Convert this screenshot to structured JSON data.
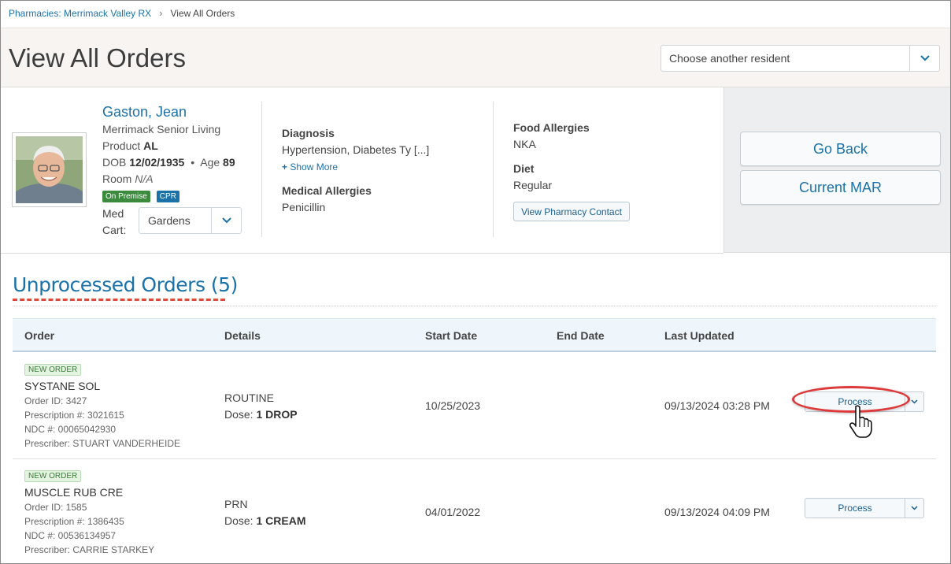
{
  "breadcrumb": {
    "parent": "Pharmacies: Merrimack Valley RX",
    "separator": "›",
    "current": "View All Orders"
  },
  "header": {
    "title": "View All Orders",
    "resident_select_placeholder": "Choose another resident"
  },
  "resident": {
    "name": "Gaston, Jean",
    "facility": "Merrimack Senior Living",
    "product_label": "Product",
    "product_value": "AL",
    "dob_label": "DOB",
    "dob_value": "12/02/1935",
    "bullet": "•",
    "age_label": "Age",
    "age_value": "89",
    "room_label": "Room",
    "room_value": "N/A",
    "badges": [
      "On Premise",
      "CPR"
    ],
    "med_cart_label": "Med Cart:",
    "med_cart_value": "Gardens"
  },
  "clinical": {
    "diagnosis_label": "Diagnosis",
    "diagnosis_value": "Hypertension, Diabetes Ty [...]",
    "show_more": "Show More",
    "medical_allergies_label": "Medical Allergies",
    "medical_allergies_value": "Penicillin",
    "food_allergies_label": "Food Allergies",
    "food_allergies_value": "NKA",
    "diet_label": "Diet",
    "diet_value": "Regular",
    "pharmacy_contact_button": "View Pharmacy Contact"
  },
  "actions": {
    "go_back": "Go Back",
    "current_mar": "Current MAR"
  },
  "section": {
    "title": "Unprocessed Orders (5)"
  },
  "table": {
    "columns": [
      "Order",
      "Details",
      "Start Date",
      "End Date",
      "Last Updated"
    ],
    "rows": [
      {
        "badge": "NEW ORDER",
        "drug": "SYSTANE SOL",
        "order_id": "Order ID: 3427",
        "prescription": "Prescription #: 3021615",
        "ndc": "NDC #: 00065042930",
        "prescriber": "Prescriber: STUART VANDERHEIDE",
        "frequency": "ROUTINE",
        "dose_label": "Dose:",
        "dose_value": "1 DROP",
        "start_date": "10/25/2023",
        "end_date": "",
        "last_updated": "09/13/2024 03:28 PM",
        "action": "Process"
      },
      {
        "badge": "NEW ORDER",
        "drug": "MUSCLE RUB CRE",
        "order_id": "Order ID: 1585",
        "prescription": "Prescription #: 1386435",
        "ndc": "NDC #: 00536134957",
        "prescriber": "Prescriber: CARRIE STARKEY",
        "frequency": "PRN",
        "dose_label": "Dose:",
        "dose_value": "1 CREAM",
        "start_date": "04/01/2022",
        "end_date": "",
        "last_updated": "09/13/2024 04:09 PM",
        "action": "Process"
      }
    ]
  },
  "colors": {
    "link": "#1a72a8",
    "highlight": "#dd3b3b",
    "badge_green": "#3b8a3e",
    "badge_blue": "#1a72a8"
  },
  "icons": {
    "breadcrumb_separator": "chevron-right-icon",
    "select_caret": "chevron-down-icon",
    "show_more": "plus-icon",
    "cursor": "hand-pointer-icon"
  }
}
